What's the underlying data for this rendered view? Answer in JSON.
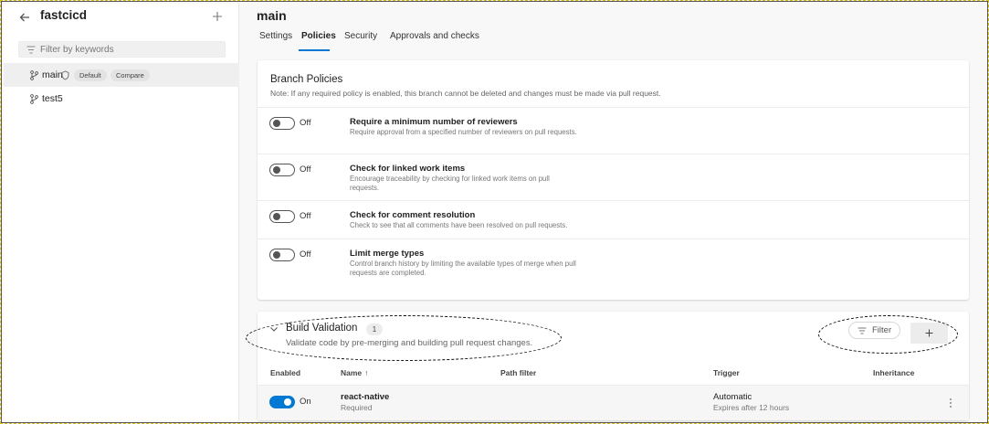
{
  "sidebar": {
    "repo_name": "fastcicd",
    "filter_placeholder": "Filter by keywords",
    "branches": [
      {
        "name": "main",
        "badges": [
          "Default",
          "Compare"
        ],
        "selected": true
      },
      {
        "name": "test5",
        "badges": [],
        "selected": false
      }
    ]
  },
  "header": {
    "title": "main",
    "tabs": [
      {
        "label": "Settings",
        "active": false
      },
      {
        "label": "Policies",
        "active": true
      },
      {
        "label": "Security",
        "active": false
      },
      {
        "label": "Approvals and checks",
        "active": false
      }
    ]
  },
  "branch_policies": {
    "title": "Branch Policies",
    "note": "Note: If any required policy is enabled, this branch cannot be deleted and changes must be made via pull request.",
    "policies": [
      {
        "name": "Require a minimum number of reviewers",
        "description": "Require approval from a specified number of reviewers on pull requests.",
        "state": "Off"
      },
      {
        "name": "Check for linked work items",
        "description": "Encourage traceability by checking for linked work items on pull requests.",
        "state": "Off"
      },
      {
        "name": "Check for comment resolution",
        "description": "Check to see that all comments have been resolved on pull requests.",
        "state": "Off"
      },
      {
        "name": "Limit merge types",
        "description": "Control branch history by limiting the available types of merge when pull requests are completed.",
        "state": "Off"
      }
    ]
  },
  "build_validation": {
    "title": "Build Validation",
    "count": "1",
    "description": "Validate code by pre-merging and building pull request changes.",
    "filter_label": "Filter",
    "columns": [
      "Enabled",
      "Name",
      "Path filter",
      "Trigger",
      "Inheritance"
    ],
    "sort_indicator": "↑",
    "rows": [
      {
        "enabled": "On",
        "name": "react-native",
        "requirement": "Required",
        "path_filter": "",
        "trigger": "Automatic",
        "trigger_detail": "Expires after 12 hours",
        "inheritance": ""
      }
    ]
  },
  "colors": {
    "accent": "#0078d4",
    "annotation_border": "#d6c21a"
  }
}
